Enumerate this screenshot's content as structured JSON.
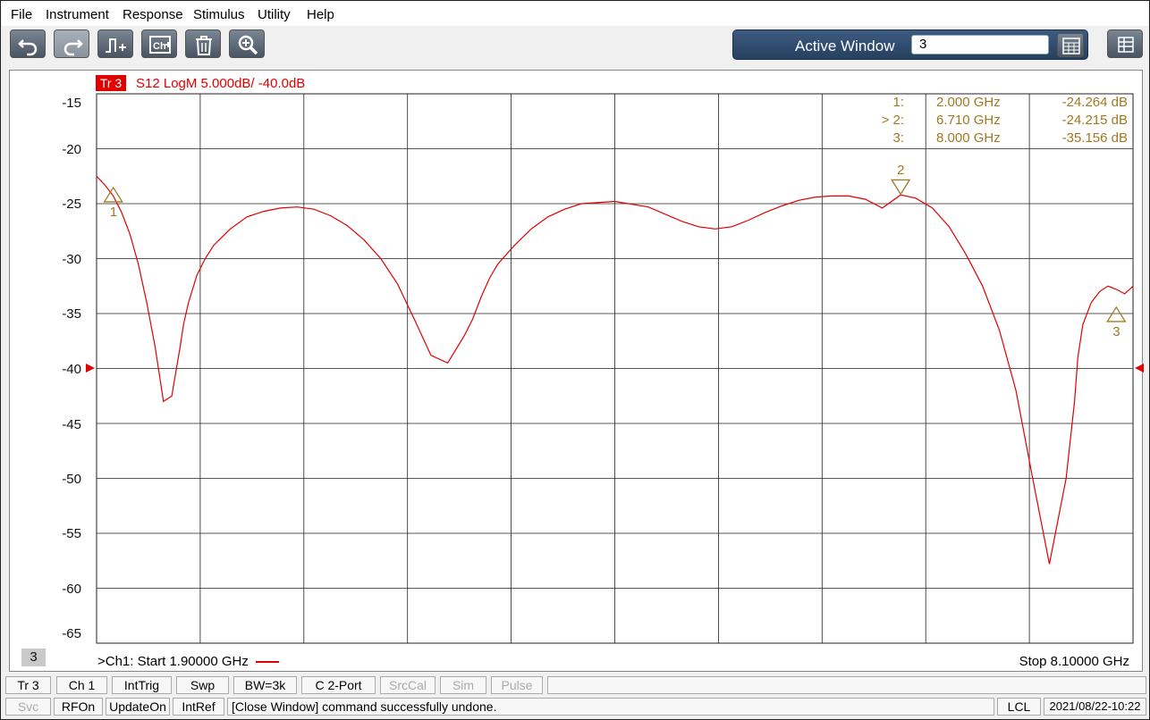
{
  "menu": [
    "File",
    "Instrument",
    "Response",
    "Stimulus",
    "Utility",
    "Help"
  ],
  "toolbar": {
    "buttons": [
      "undo-icon",
      "redo-icon",
      "marker-add-icon",
      "channel-add-icon",
      "trash-icon",
      "zoom-icon"
    ],
    "active_window_label": "Active Window",
    "active_window_value": "3"
  },
  "trace": {
    "badge": "Tr 3",
    "info": "S12 LogM 5.000dB/  -40.0dB",
    "color": "#e00000",
    "window_number": "3",
    "start_label": ">Ch1:  Start   1.90000 GHz",
    "stop_label": "Stop  8.10000 GHz"
  },
  "markers": [
    {
      "id": "1:",
      "freq": "2.000  GHz",
      "value": "-24.264 dB",
      "label": "1"
    },
    {
      "id": "> 2:",
      "freq": "6.710  GHz",
      "value": "-24.215 dB",
      "label": "2"
    },
    {
      "id": "3:",
      "freq": "8.000  GHz",
      "value": "-35.156 dB",
      "label": "3"
    }
  ],
  "chart_data": {
    "type": "line",
    "x_range": [
      1.9,
      8.1
    ],
    "ylim": [
      -65,
      -15
    ],
    "reference_level": -40,
    "yticks": [
      -15,
      -20,
      -25,
      -30,
      -35,
      -40,
      -45,
      -50,
      -55,
      -60,
      -65
    ],
    "series": [
      {
        "x": [
          1.9,
          1.95,
          2.0,
          2.05,
          2.1,
          2.15,
          2.2,
          2.25,
          2.3,
          2.35,
          2.4,
          2.42,
          2.45,
          2.5,
          2.55,
          2.6,
          2.7,
          2.8,
          2.9,
          3.0,
          3.1,
          3.2,
          3.3,
          3.4,
          3.5,
          3.6,
          3.7,
          3.8,
          3.9,
          4.0,
          4.1,
          4.15,
          4.2,
          4.25,
          4.3,
          4.4,
          4.5,
          4.6,
          4.7,
          4.8,
          5.0,
          5.2,
          5.4,
          5.5,
          5.6,
          5.7,
          5.8,
          5.9,
          6.0,
          6.1,
          6.2,
          6.3,
          6.4,
          6.5,
          6.6,
          6.71,
          6.8,
          6.9,
          7.0,
          7.1,
          7.2,
          7.3,
          7.4,
          7.5,
          7.6,
          7.7,
          7.75,
          7.77,
          7.8,
          7.85,
          7.9,
          7.95,
          8.0,
          8.05,
          8.1
        ],
        "y": [
          -22.5,
          -23.3,
          -24.3,
          -25.8,
          -27.8,
          -30.5,
          -34.0,
          -38.0,
          -43.0,
          -42.5,
          -38.0,
          -36.0,
          -34.0,
          -31.5,
          -30.0,
          -28.8,
          -27.3,
          -26.2,
          -25.7,
          -25.4,
          -25.3,
          -25.5,
          -26.1,
          -27.0,
          -28.3,
          -30.0,
          -32.3,
          -35.5,
          -38.8,
          -39.5,
          -37.0,
          -35.5,
          -33.5,
          -31.8,
          -30.5,
          -28.8,
          -27.3,
          -26.2,
          -25.5,
          -25.0,
          -24.8,
          -25.3,
          -26.6,
          -27.1,
          -27.3,
          -27.1,
          -26.5,
          -25.8,
          -25.2,
          -24.7,
          -24.4,
          -24.3,
          -24.3,
          -24.6,
          -25.4,
          -24.2,
          -24.5,
          -25.4,
          -27.1,
          -29.6,
          -32.5,
          -36.5,
          -42.0,
          -50.0,
          -57.8,
          -50.0,
          -43.0,
          -39.0,
          -36.0,
          -34.0,
          -33.0,
          -32.5,
          -32.8,
          -33.2,
          -32.5
        ]
      }
    ]
  },
  "status_row1": [
    "Tr 3",
    "Ch 1",
    "IntTrig",
    "Swp",
    "BW=3k",
    "C  2-Port",
    "SrcCal",
    "Sim",
    "Pulse"
  ],
  "status_row2": [
    "Svc",
    "RFOn",
    "UpdateOn",
    "IntRef",
    "[Close Window] command successfully undone.",
    "LCL",
    "2021/08/22-10:22"
  ]
}
